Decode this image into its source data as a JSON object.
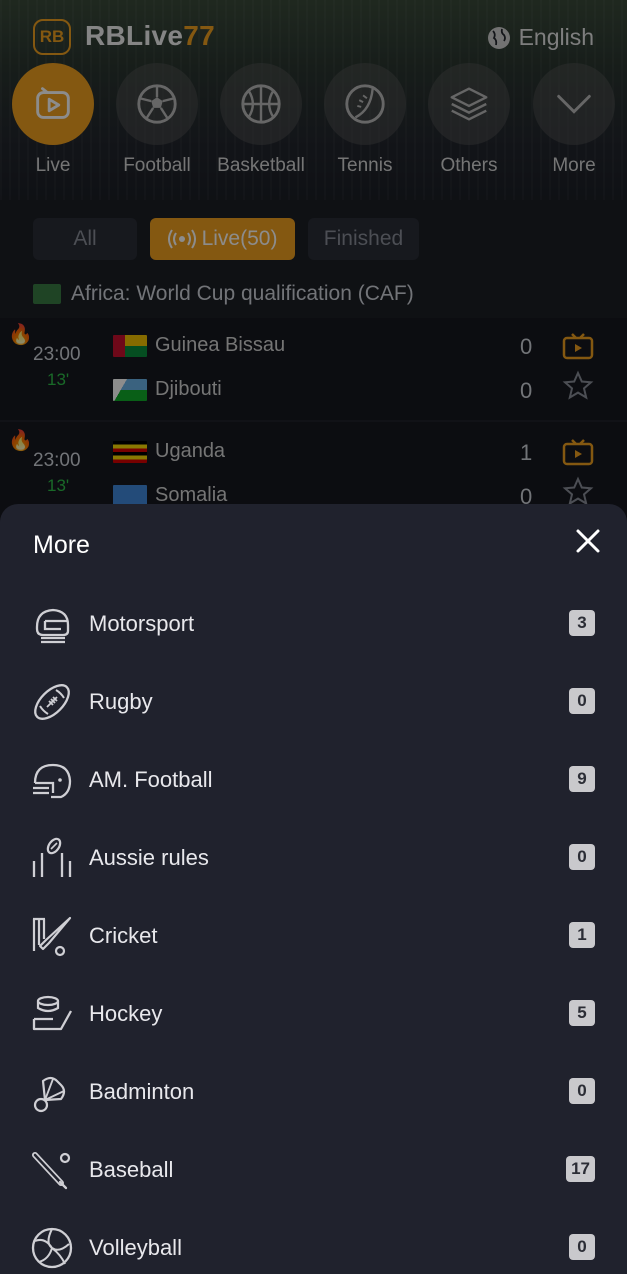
{
  "header": {
    "logo_text": "RB",
    "brand_main": "RBLive",
    "brand_accent": "77",
    "language": "English",
    "accent_color": "#f0a020"
  },
  "categories": [
    {
      "label": "Live",
      "icon": "live-tv-icon",
      "active": true
    },
    {
      "label": "Football",
      "icon": "football-icon"
    },
    {
      "label": "Basketball",
      "icon": "basketball-icon"
    },
    {
      "label": "Tennis",
      "icon": "tennis-icon"
    },
    {
      "label": "Others",
      "icon": "layers-icon"
    },
    {
      "label": "More",
      "icon": "chevron-down-icon"
    }
  ],
  "filters": {
    "all": "All",
    "live": "Live(50)",
    "finished": "Finished",
    "active": "live"
  },
  "league": {
    "name": "Africa: World Cup qualification (CAF)"
  },
  "matches": [
    {
      "time": "23:00",
      "minute": "13'",
      "home": "Guinea Bissau",
      "away": "Djibouti",
      "home_score": "0",
      "away_score": "0"
    },
    {
      "time": "23:00",
      "minute": "13'",
      "home": "Uganda",
      "away": "Somalia",
      "home_score": "1",
      "away_score": "0"
    }
  ],
  "sheet": {
    "title": "More",
    "items": [
      {
        "name": "Motorsport",
        "count": "3",
        "icon": "helmet-icon"
      },
      {
        "name": "Rugby",
        "count": "0",
        "icon": "rugby-ball-icon"
      },
      {
        "name": "AM. Football",
        "count": "9",
        "icon": "football-helmet-icon"
      },
      {
        "name": "Aussie rules",
        "count": "0",
        "icon": "goalposts-icon"
      },
      {
        "name": "Cricket",
        "count": "1",
        "icon": "cricket-icon"
      },
      {
        "name": "Hockey",
        "count": "5",
        "icon": "hockey-icon"
      },
      {
        "name": "Badminton",
        "count": "0",
        "icon": "shuttlecock-icon"
      },
      {
        "name": "Baseball",
        "count": "17",
        "icon": "baseball-icon"
      },
      {
        "name": "Volleyball",
        "count": "0",
        "icon": "volleyball-icon"
      }
    ]
  }
}
